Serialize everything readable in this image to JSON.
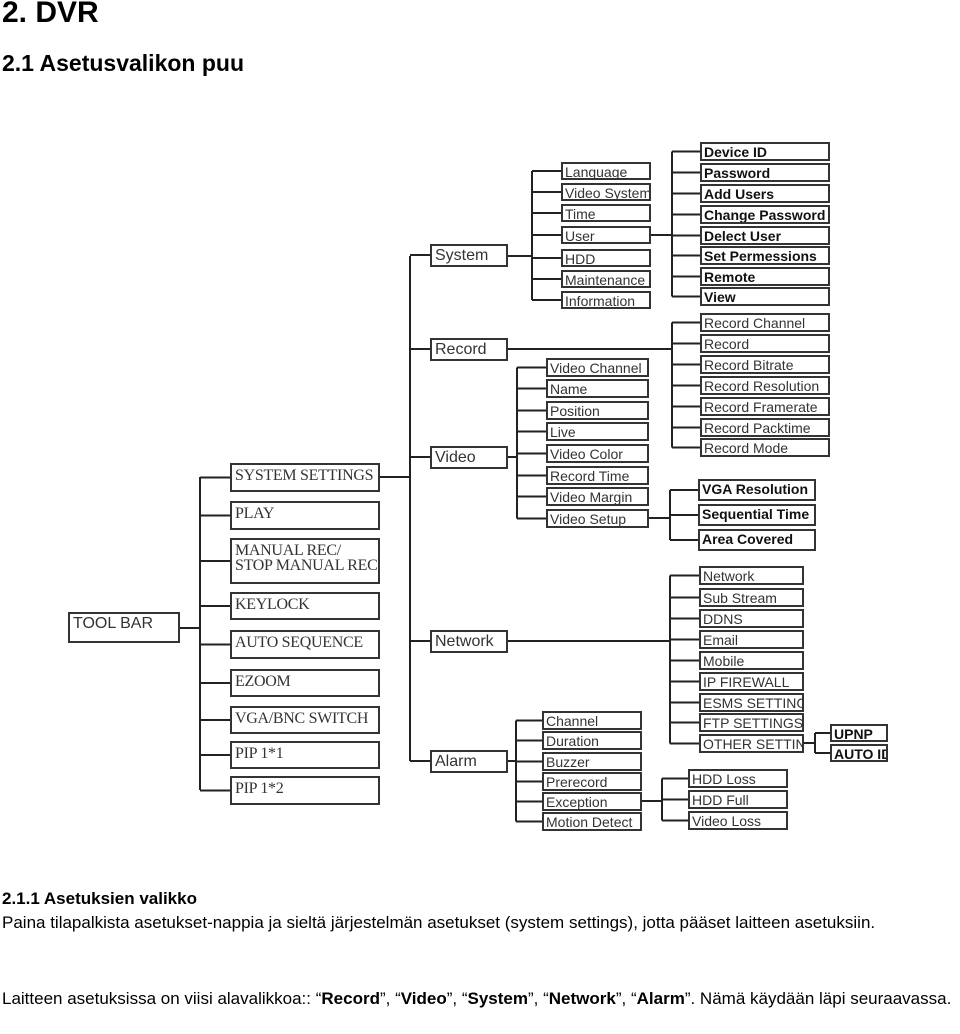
{
  "heading": "2. DVR",
  "subheading": "2.1 Asetusvalikon puu",
  "tree": {
    "root": "TOOL BAR",
    "toolbar_items": [
      "SYSTEM SETTINGS",
      "PLAY",
      "MANUAL REC/\nSTOP MANUAL REC",
      "KEYLOCK",
      "AUTO SEQUENCE",
      "EZOOM",
      "VGA/BNC SWITCH",
      "PIP 1*1",
      "PIP 1*2"
    ],
    "system_settings": [
      "System",
      "Record",
      "Video",
      "Network",
      "Alarm"
    ],
    "system": [
      "Language",
      "Video System",
      "Time",
      "User",
      "HDD",
      "Maintenance",
      "Information"
    ],
    "user": [
      "Device ID",
      "Password",
      "Add Users",
      "Change Password",
      "Delect User",
      "Set Permessions",
      "Remote",
      "View"
    ],
    "record": [
      "Record Channel",
      "Record",
      "Record Bitrate",
      "Record Resolution",
      "Record Framerate",
      "Record Packtime",
      "Record Mode"
    ],
    "video": [
      "Video Channel",
      "Name",
      "Position",
      "Live",
      "Video Color",
      "Record Time",
      "Video Margin",
      "Video Setup"
    ],
    "video_setup": [
      "VGA Resolution",
      "Sequential Time",
      "Area Covered"
    ],
    "network": [
      "Network",
      "Sub Stream",
      "DDNS",
      "Email",
      "Mobile",
      "IP FIREWALL",
      "ESMS SETTINGS",
      "FTP SETTINGS",
      "OTHER SETTINGS"
    ],
    "other_settings": [
      "UPNP",
      "AUTO ID"
    ],
    "alarm": [
      "Channel",
      "Duration",
      "Buzzer",
      "Prerecord",
      "Exception",
      "Motion Detect"
    ],
    "exception": [
      "HDD Loss",
      "HDD Full",
      "Video Loss"
    ]
  },
  "section": {
    "title": "2.1.1 Asetuksien valikko",
    "para1": "Paina tilapalkista asetukset-nappia ja sieltä järjestelmän asetukset (system settings), jotta pääset laitteen asetuksiin.",
    "para2_prefix": "Laitteen asetuksissa on viisi alavalikkoa:: “",
    "items": [
      "Record",
      "Video",
      "System",
      "Network",
      "Alarm"
    ],
    "para2_suffix": "”. Nämä käydään läpi seuraavassa."
  }
}
